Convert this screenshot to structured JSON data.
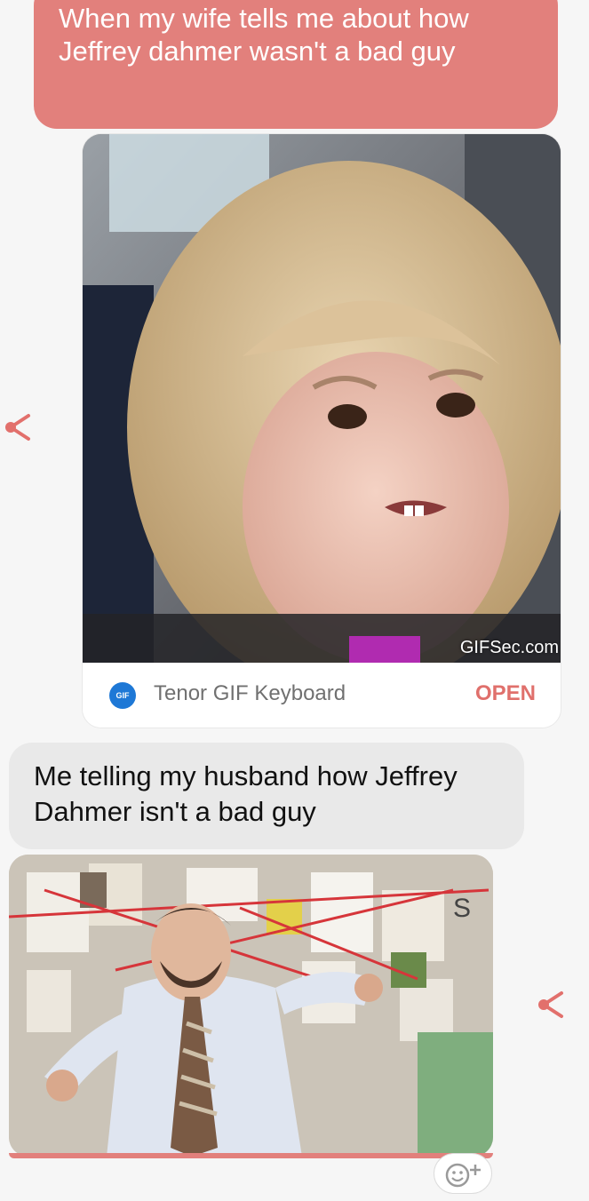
{
  "messages": {
    "outgoing": {
      "text": "When my wife tells me about how Jeffrey dahmer wasn't a bad guy"
    },
    "gif_card": {
      "watermark": "GIFSec.com",
      "badge": "GIF",
      "source_label": "Tenor GIF Keyboard",
      "open_label": "OPEN"
    },
    "incoming": {
      "text": "Me telling my husband how Jeffrey Dahmer isn't a bad guy"
    },
    "gif2_sign": "S"
  },
  "icons": {
    "share_left": "share-icon",
    "share_right": "share-icon",
    "emoji_add": "emoji-add-icon"
  },
  "colors": {
    "outgoing_bubble": "#e2807c",
    "incoming_bubble": "#e9e9e9",
    "accent": "#e0706c",
    "background": "#f6f6f6"
  }
}
